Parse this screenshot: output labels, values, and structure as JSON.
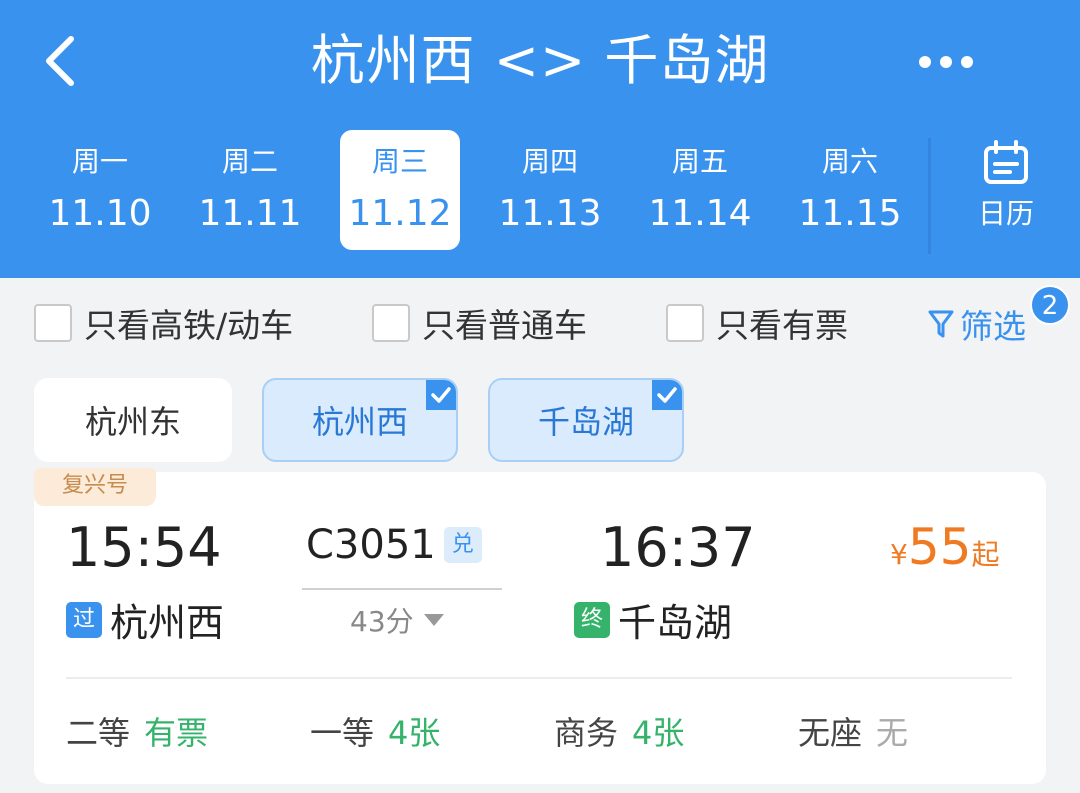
{
  "header": {
    "title": "杭州西 <> 千岛湖",
    "colors": {
      "primary": "#3a92ef",
      "price": "#f07a22",
      "available": "#36b36b"
    },
    "days": [
      {
        "weekday": "周一",
        "date": "11.10"
      },
      {
        "weekday": "周二",
        "date": "11.11"
      },
      {
        "weekday": "周三",
        "date": "11.12"
      },
      {
        "weekday": "周四",
        "date": "11.13"
      },
      {
        "weekday": "周五",
        "date": "11.14"
      },
      {
        "weekday": "周六",
        "date": "11.15"
      }
    ],
    "selected_day": "11.12",
    "calendar_label": "日历"
  },
  "filters": {
    "high_speed": "只看高铁/动车",
    "normal": "只看普通车",
    "available": "只看有票",
    "screen_label": "筛选",
    "screen_count": "2"
  },
  "stations": [
    {
      "name": "杭州东",
      "selected": false
    },
    {
      "name": "杭州西",
      "selected": true
    },
    {
      "name": "千岛湖",
      "selected": true
    }
  ],
  "train": {
    "tag": "复兴号",
    "depart_time": "15:54",
    "depart_mark": "过",
    "depart_station": "杭州西",
    "train_no": "C3051",
    "redeem_mark": "兑",
    "duration": "43分",
    "arrive_time": "16:37",
    "arrive_mark": "终",
    "arrive_station": "千岛湖",
    "price_symbol": "¥",
    "price": "55",
    "price_suffix": "起",
    "seats": [
      {
        "class": "二等",
        "status": "有票",
        "available": true
      },
      {
        "class": "一等",
        "status": "4张",
        "available": true
      },
      {
        "class": "商务",
        "status": "4张",
        "available": true
      },
      {
        "class": "无座",
        "status": "无",
        "available": false
      }
    ]
  }
}
